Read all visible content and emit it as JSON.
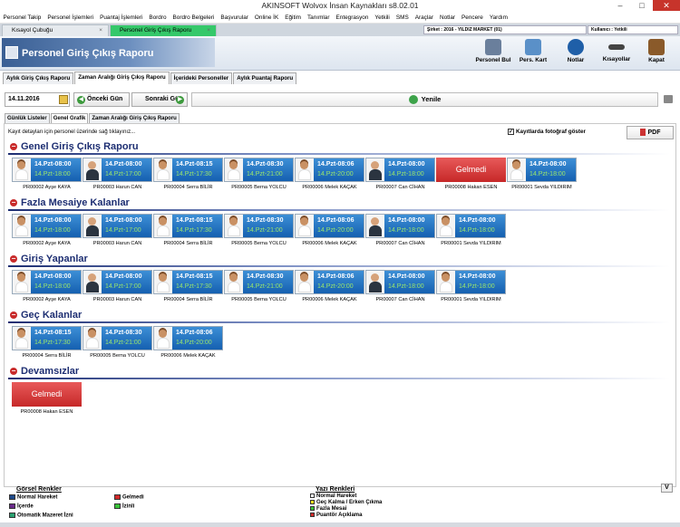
{
  "window": {
    "title": "AKINSOFT Wolvox İnsan Kaynakları s8.02.01"
  },
  "menu": [
    "Personel Takip",
    "Personel İşlemleri",
    "Puantaj İşlemleri",
    "Bordro",
    "Bordro Belgeleri",
    "Başvurular",
    "Online İK",
    "Eğitim",
    "Tanımlar",
    "Entegrasyon",
    "Yetkili",
    "SMS",
    "Araçlar",
    "Notlar",
    "Pencere",
    "Yardım"
  ],
  "tabs": [
    {
      "label": "Kısayol Çubuğu"
    },
    {
      "label": "Personel Giriş Çıkış Raporu"
    }
  ],
  "company": "Şirket : 2016 - YILDIZ MARKET (01)",
  "user": "Kullanıcı : Yetkili",
  "header": {
    "title": "Personel Giriş Çıkış Raporu",
    "buttons": [
      "Personel Bul",
      "Pers. Kart",
      "Notlar",
      "Kısayollar",
      "Kapat"
    ]
  },
  "subtabs": [
    "Aylık Giriş Çıkış Raporu",
    "Zaman Aralığı Giriş Çıkış Raporu",
    "İçerideki Personeller",
    "Aylık Puantaj Raporu"
  ],
  "datebar": {
    "date": "14.11.2016",
    "prev": "Önceki Gün",
    "next": "Sonraki Gün",
    "refresh": "Yenile"
  },
  "tabs2": [
    "Günlük Listeler",
    "Genel Grafik",
    "Zaman Aralığı Giriş Çıkış Raporu"
  ],
  "content": {
    "hint": "Kayıt detayları için personel üzerinde sağ tıklayınız...",
    "photo_check": "Kayıtlarda fotoğraf göster",
    "pdf": "PDF",
    "absent_label": "Gelmedi"
  },
  "sections": [
    {
      "title": "Genel Giriş Çıkış Raporu",
      "cards": [
        {
          "in": "14.Pzt-08:00",
          "out": "14.Pzt-18:00",
          "name": "PR00002 Ayşe KAYA",
          "g": "f"
        },
        {
          "in": "14.Pzt-08:00",
          "out": "14.Pzt-17:00",
          "name": "PR00003 Harun CAN",
          "g": "m"
        },
        {
          "in": "14.Pzt-08:15",
          "out": "14.Pzt-17:30",
          "name": "PR00004 Serra BİLİR",
          "g": "f"
        },
        {
          "in": "14.Pzt-08:30",
          "out": "14.Pzt-21:00",
          "name": "PR00005 Berna YOLCU",
          "g": "f"
        },
        {
          "in": "14.Pzt-08:06",
          "out": "14.Pzt-20:00",
          "name": "PR00006 Melek KAÇAK",
          "g": "f"
        },
        {
          "in": "14.Pzt-08:00",
          "out": "14.Pzt-18:00",
          "name": "PR00007 Can CİHAN",
          "g": "m"
        },
        {
          "absent": true,
          "name": "PR00008 Hakan ESEN"
        },
        {
          "in": "14.Pzt-08:00",
          "out": "14.Pzt-18:00",
          "name": "PR00001 Sevda YILDIRIM",
          "g": "f"
        }
      ]
    },
    {
      "title": "Fazla Mesaiye Kalanlar",
      "cards": [
        {
          "in": "14.Pzt-08:00",
          "out": "14.Pzt-18:00",
          "name": "PR00002 Ayşe KAYA",
          "g": "f"
        },
        {
          "in": "14.Pzt-08:00",
          "out": "14.Pzt-17:00",
          "name": "PR00003 Harun CAN",
          "g": "m"
        },
        {
          "in": "14.Pzt-08:15",
          "out": "14.Pzt-17:30",
          "name": "PR00004 Serra BİLİR",
          "g": "f"
        },
        {
          "in": "14.Pzt-08:30",
          "out": "14.Pzt-21:00",
          "name": "PR00005 Berna YOLCU",
          "g": "f"
        },
        {
          "in": "14.Pzt-08:06",
          "out": "14.Pzt-20:00",
          "name": "PR00006 Melek KAÇAK",
          "g": "f"
        },
        {
          "in": "14.Pzt-08:00",
          "out": "14.Pzt-18:00",
          "name": "PR00007 Can CİHAN",
          "g": "m"
        },
        {
          "in": "14.Pzt-08:00",
          "out": "14.Pzt-18:00",
          "name": "PR00001 Sevda YILDIRIM",
          "g": "f"
        }
      ]
    },
    {
      "title": "Giriş Yapanlar",
      "cards": [
        {
          "in": "14.Pzt-08:00",
          "out": "14.Pzt-18:00",
          "name": "PR00002 Ayşe KAYA",
          "g": "f"
        },
        {
          "in": "14.Pzt-08:00",
          "out": "14.Pzt-17:00",
          "name": "PR00003 Harun CAN",
          "g": "m"
        },
        {
          "in": "14.Pzt-08:15",
          "out": "14.Pzt-17:30",
          "name": "PR00004 Serra BİLİR",
          "g": "f"
        },
        {
          "in": "14.Pzt-08:30",
          "out": "14.Pzt-21:00",
          "name": "PR00005 Berna YOLCU",
          "g": "f"
        },
        {
          "in": "14.Pzt-08:06",
          "out": "14.Pzt-20:00",
          "name": "PR00006 Melek KAÇAK",
          "g": "f"
        },
        {
          "in": "14.Pzt-08:00",
          "out": "14.Pzt-18:00",
          "name": "PR00007 Can CİHAN",
          "g": "m"
        },
        {
          "in": "14.Pzt-08:00",
          "out": "14.Pzt-18:00",
          "name": "PR00001 Sevda YILDIRIM",
          "g": "f"
        }
      ]
    },
    {
      "title": "Geç Kalanlar",
      "cards": [
        {
          "in": "14.Pzt-08:15",
          "out": "14.Pzt-17:30",
          "name": "PR00004 Serra BİLİR",
          "g": "f"
        },
        {
          "in": "14.Pzt-08:30",
          "out": "14.Pzt-21:00",
          "name": "PR00005 Berna YOLCU",
          "g": "f"
        },
        {
          "in": "14.Pzt-08:06",
          "out": "14.Pzt-20:00",
          "name": "PR00006 Melek KAÇAK",
          "g": "f"
        }
      ]
    },
    {
      "title": "Devamsızlar",
      "cards": [
        {
          "absent": true,
          "name": "PR00008 Hakan ESEN"
        }
      ]
    }
  ],
  "legend": {
    "visual_title": "Görsel Renkler",
    "visual": [
      {
        "label": "Normal Hareket",
        "color": "#1f4a8a"
      },
      {
        "label": "İçerde",
        "color": "#6a2a8a"
      },
      {
        "label": "Otomatik Mazeret İzni",
        "color": "#2aa070"
      },
      {
        "label": "Gelmedi",
        "color": "#d22a2a"
      },
      {
        "label": "İzinli",
        "color": "#3ac23a"
      }
    ],
    "text_title": "Yazı Renkleri",
    "text": [
      {
        "label": "Normal Hareket",
        "color": "#ffffff"
      },
      {
        "label": "Geç Kalma / Erken Çıkma",
        "color": "#f0e020"
      },
      {
        "label": "Fazla Mesai",
        "color": "#3ac23a"
      },
      {
        "label": "Puantör Açıklama",
        "color": "#d22a2a"
      }
    ],
    "toggle": "V"
  }
}
